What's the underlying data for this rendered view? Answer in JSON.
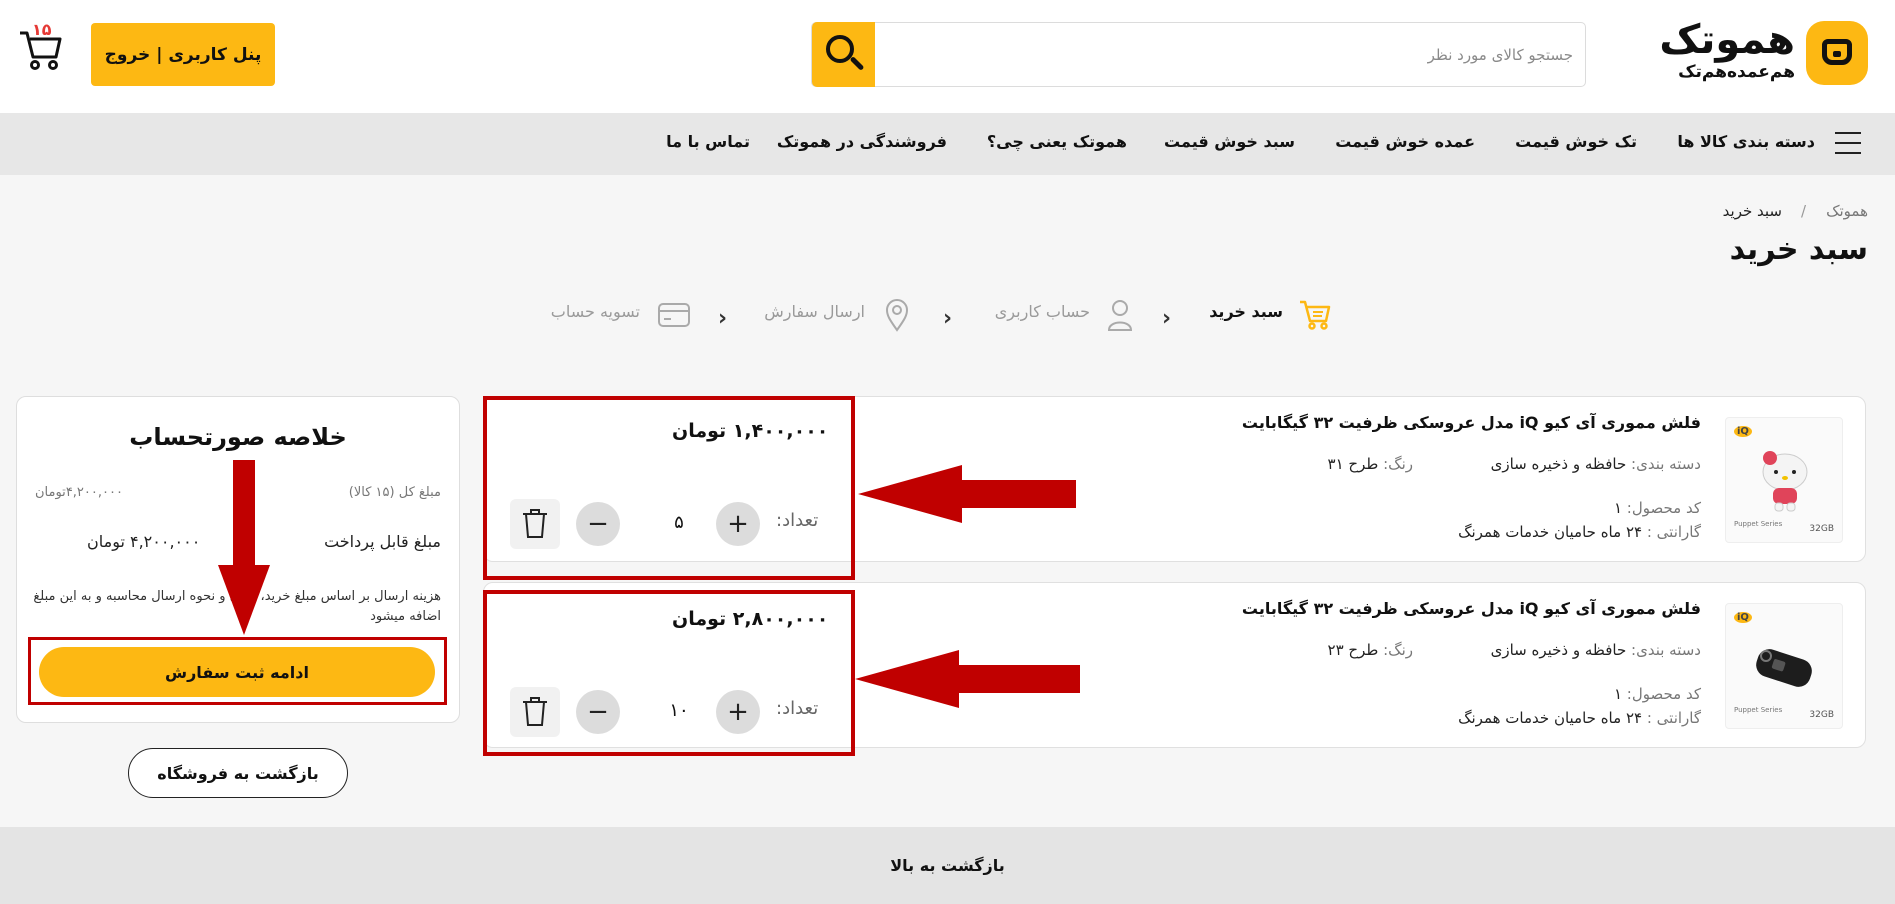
{
  "header": {
    "logo_title": "همو‌تک",
    "logo_subtitle": "هم‌عمده‌هم‌تک",
    "search_placeholder": "جستجو کالای مورد نظر",
    "user_button": "پنل کاربری | خروج",
    "cart_count": "۱۵"
  },
  "nav": {
    "items": [
      "دسته بندی کالا ها",
      "تک خوش قیمت",
      "عمده خوش قیمت",
      "سبد خوش قیمت",
      "هموتک یعنی چی؟",
      "فروشندگی در هموتک",
      "تماس با ما"
    ]
  },
  "breadcrumb": {
    "home": "هموتک",
    "separator": "/",
    "current": "سبد خرید"
  },
  "page_title": "سبد خرید",
  "steps": [
    "سبد خرید",
    "حساب کاربری",
    "ارسال سفارش",
    "تسویه حساب"
  ],
  "summary": {
    "title": "خلاصه صورتحساب",
    "total_label": "مبلغ کل (۱۵ کالا)",
    "total_value": "۴,۲۰۰,۰۰۰تومان",
    "payable_label": "مبلغ قابل پرداخت",
    "payable_value": "۴,۲۰۰,۰۰۰ تومان",
    "note": "هزینه ارسال بر اساس مبلغ خرید، زمان و نحوه ارسال محاسبه و به این مبلغ اضافه میشود",
    "continue_button": "ادامه ثبت سفارش"
  },
  "back_to_shop": "بازگشت به فروشگاه",
  "cart_items": [
    {
      "name": "فلش مموری آی کیو iQ مدل عروسکی ظرفیت ۳۲ گیگابایت",
      "category_label": "دسته بندی:",
      "category": "حافظه و ذخیره سازی",
      "color_label": "رنگ:",
      "color": "طرح ۳۱",
      "code_label": "کد محصول:",
      "code": "۱",
      "warranty_label": "گارانتی :",
      "warranty": "۲۴ ماه حامیان خدمات همرنگ",
      "price": "۱,۴۰۰,۰۰۰ تومان",
      "qty_label": "تعداد:",
      "qty": "۵"
    },
    {
      "name": "فلش مموری آی کیو iQ مدل عروسکی ظرفیت ۳۲ گیگابایت",
      "category_label": "دسته بندی:",
      "category": "حافظه و ذخیره سازی",
      "color_label": "رنگ:",
      "color": "طرح ۲۳",
      "code_label": "کد محصول:",
      "code": "۱",
      "warranty_label": "گارانتی :",
      "warranty": "۲۴ ماه حامیان خدمات همرنگ",
      "price": "۲,۸۰۰,۰۰۰ تومان",
      "qty_label": "تعداد:",
      "qty": "۱۰"
    }
  ],
  "product_image": {
    "brand": "iQ",
    "capacity": "32GB",
    "series": "Puppet Series"
  },
  "footer": {
    "back_to_top": "بازگشت به بالا"
  },
  "colors": {
    "accent": "#fdb813",
    "annotation": "#c00000"
  }
}
